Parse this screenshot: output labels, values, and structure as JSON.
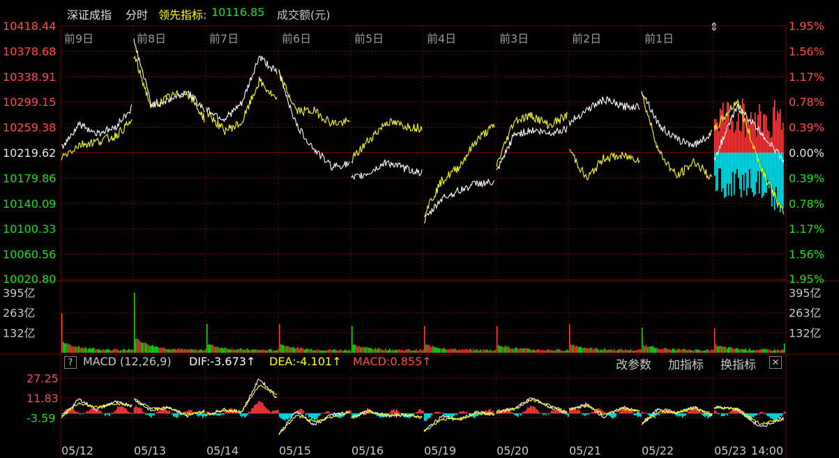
{
  "header": {
    "title": "深证成指",
    "mode": "分时",
    "lead_label": "领先指标:",
    "lead_value": "10116.85",
    "amount_label": "成交额(元)"
  },
  "macd_header": {
    "help": "?",
    "name": "MACD (12,26,9)",
    "dif": "DIF:-3.673↑",
    "dea": "DEA:-4.101↑",
    "macd": "MACD:0.855↑"
  },
  "buttons": {
    "params": "改参数",
    "add": "加指标",
    "switch": "换指标",
    "close": "✕"
  },
  "colors": {
    "up": "#ff4b4b",
    "down": "#16e016",
    "flat": "#e6e6e6",
    "lead": "#ffff00",
    "macd_neg": "#00e5ee",
    "grid": "#7a0000"
  },
  "chart_data": {
    "type": "line",
    "price_axis": {
      "labels": [
        "10418.44",
        "10378.68",
        "10338.91",
        "10299.15",
        "10259.38",
        "10219.62",
        "10179.86",
        "10140.09",
        "10100.33",
        "10060.56",
        "10020.80"
      ],
      "pct_labels": [
        "1.95%",
        "1.56%",
        "1.17%",
        "0.78%",
        "0.39%",
        "0.00%",
        "0.39%",
        "0.78%",
        "1.17%",
        "1.56%",
        "1.95%"
      ],
      "ylim": [
        10020.8,
        10418.44
      ],
      "prev_close": 10219.62
    },
    "day_labels": [
      "前9日",
      "前8日",
      "前7日",
      "前6日",
      "前5日",
      "前4日",
      "前3日",
      "前2日",
      "前1日"
    ],
    "dates": [
      "05/12",
      "05/13",
      "05/14",
      "05/15",
      "05/16",
      "05/19",
      "05/20",
      "05/21",
      "05/22",
      "05/23"
    ],
    "time_label": "14:00",
    "close_series_key": [
      [
        10226,
        10265,
        10250,
        10258,
        10290
      ],
      [
        10395,
        10295,
        10302,
        10315,
        10288
      ],
      [
        10288,
        10272,
        10296,
        10370,
        10345
      ],
      [
        10345,
        10262,
        10225,
        10198,
        10202
      ],
      [
        10178,
        10188,
        10205,
        10195,
        10188
      ],
      [
        10112,
        10148,
        10160,
        10172,
        10172
      ],
      [
        10188,
        10248,
        10255,
        10250,
        10258
      ],
      [
        10266,
        10287,
        10303,
        10292,
        10292
      ],
      [
        10318,
        10262,
        10240,
        10232,
        10250
      ],
      [
        10210,
        10292,
        10252,
        10207
      ]
    ],
    "lead_series_key": [
      [
        10212,
        10232,
        10237,
        10245,
        10268
      ],
      [
        10372,
        10290,
        10307,
        10315,
        10273
      ],
      [
        10283,
        10254,
        10266,
        10332,
        10301
      ],
      [
        10342,
        10285,
        10285,
        10266,
        10267
      ],
      [
        10208,
        10240,
        10268,
        10262,
        10258
      ],
      [
        10125,
        10175,
        10198,
        10240,
        10262
      ],
      [
        10200,
        10270,
        10278,
        10262,
        10278
      ],
      [
        10226,
        10178,
        10212,
        10214,
        10210
      ],
      [
        10312,
        10220,
        10182,
        10206,
        10178
      ],
      [
        10255,
        10302,
        10198,
        10122
      ]
    ],
    "volume_axis": {
      "labels": [
        "395亿",
        "263亿",
        "132亿"
      ],
      "ylim": [
        0,
        395
      ]
    },
    "volume_open_peaks": [
      260,
      395,
      190,
      190,
      175,
      175,
      175,
      190,
      165,
      160
    ],
    "macd_axis": {
      "labels": [
        "27.25",
        "11.83",
        "-3.59"
      ],
      "ylim": [
        -20,
        33
      ]
    },
    "macd_dif_key": [
      [
        -3,
        11,
        3,
        9,
        6
      ],
      [
        11,
        2,
        5,
        -2,
        2
      ],
      [
        -1,
        3,
        1,
        27,
        12
      ],
      [
        -16,
        2,
        -9,
        -1,
        1
      ],
      [
        -3,
        2,
        -2,
        -1,
        -3
      ],
      [
        -14,
        -2,
        -5,
        1,
        -1
      ],
      [
        1,
        4,
        12,
        5,
        0
      ],
      [
        3,
        7,
        -3,
        5,
        1
      ],
      [
        -8,
        4,
        0,
        5,
        -2
      ],
      [
        5,
        3,
        -11,
        -3
      ]
    ]
  }
}
